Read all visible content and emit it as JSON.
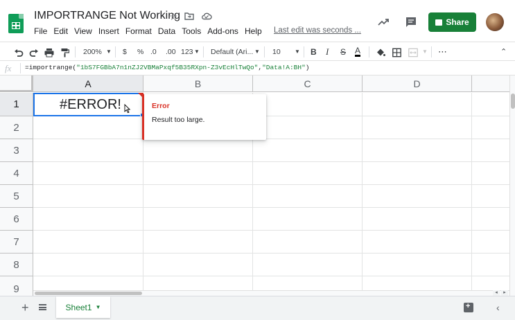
{
  "header": {
    "doc_title": "IMPORTRANGE Not Working",
    "star_icon": "star-icon",
    "move_icon": "folder-move-icon",
    "cloud_icon": "cloud-status-icon",
    "menu": [
      "File",
      "Edit",
      "View",
      "Insert",
      "Format",
      "Data",
      "Tools",
      "Add-ons",
      "Help"
    ],
    "last_edit": "Last edit was seconds ...",
    "share_label": "Share",
    "brand_color": "#0f9d58",
    "share_color": "#188038"
  },
  "toolbar": {
    "zoom": "200%",
    "currency": "$",
    "percent": "%",
    "decrease_decimals": ".0",
    "increase_decimals": ".00",
    "more_formats": "123",
    "font": "Default (Ari...",
    "font_size": "10",
    "bold": "B",
    "italic": "I",
    "strike": "S",
    "text_color": "A",
    "more": "⋯"
  },
  "formula_bar": {
    "fx": "fx",
    "formula_prefix": "=importrange(",
    "arg1": "\"1bS7FGBbA7n1nZJ2VBMaPxqf5B35RXpn-Z3vEcHlTwQo\"",
    "comma": ",",
    "arg2": "\"Data!A:BH\"",
    "formula_suffix": ")"
  },
  "grid": {
    "columns": [
      "A",
      "B",
      "C",
      "D"
    ],
    "rows": [
      "1",
      "2",
      "3",
      "4",
      "5",
      "6",
      "7",
      "8",
      "9"
    ],
    "selected_cell": "A1",
    "cell_a1": "#ERROR!"
  },
  "error_popup": {
    "title": "Error",
    "message": "Result too large.",
    "color": "#d93025"
  },
  "sheets": {
    "add_label": "+",
    "tabs": [
      "Sheet1"
    ]
  }
}
